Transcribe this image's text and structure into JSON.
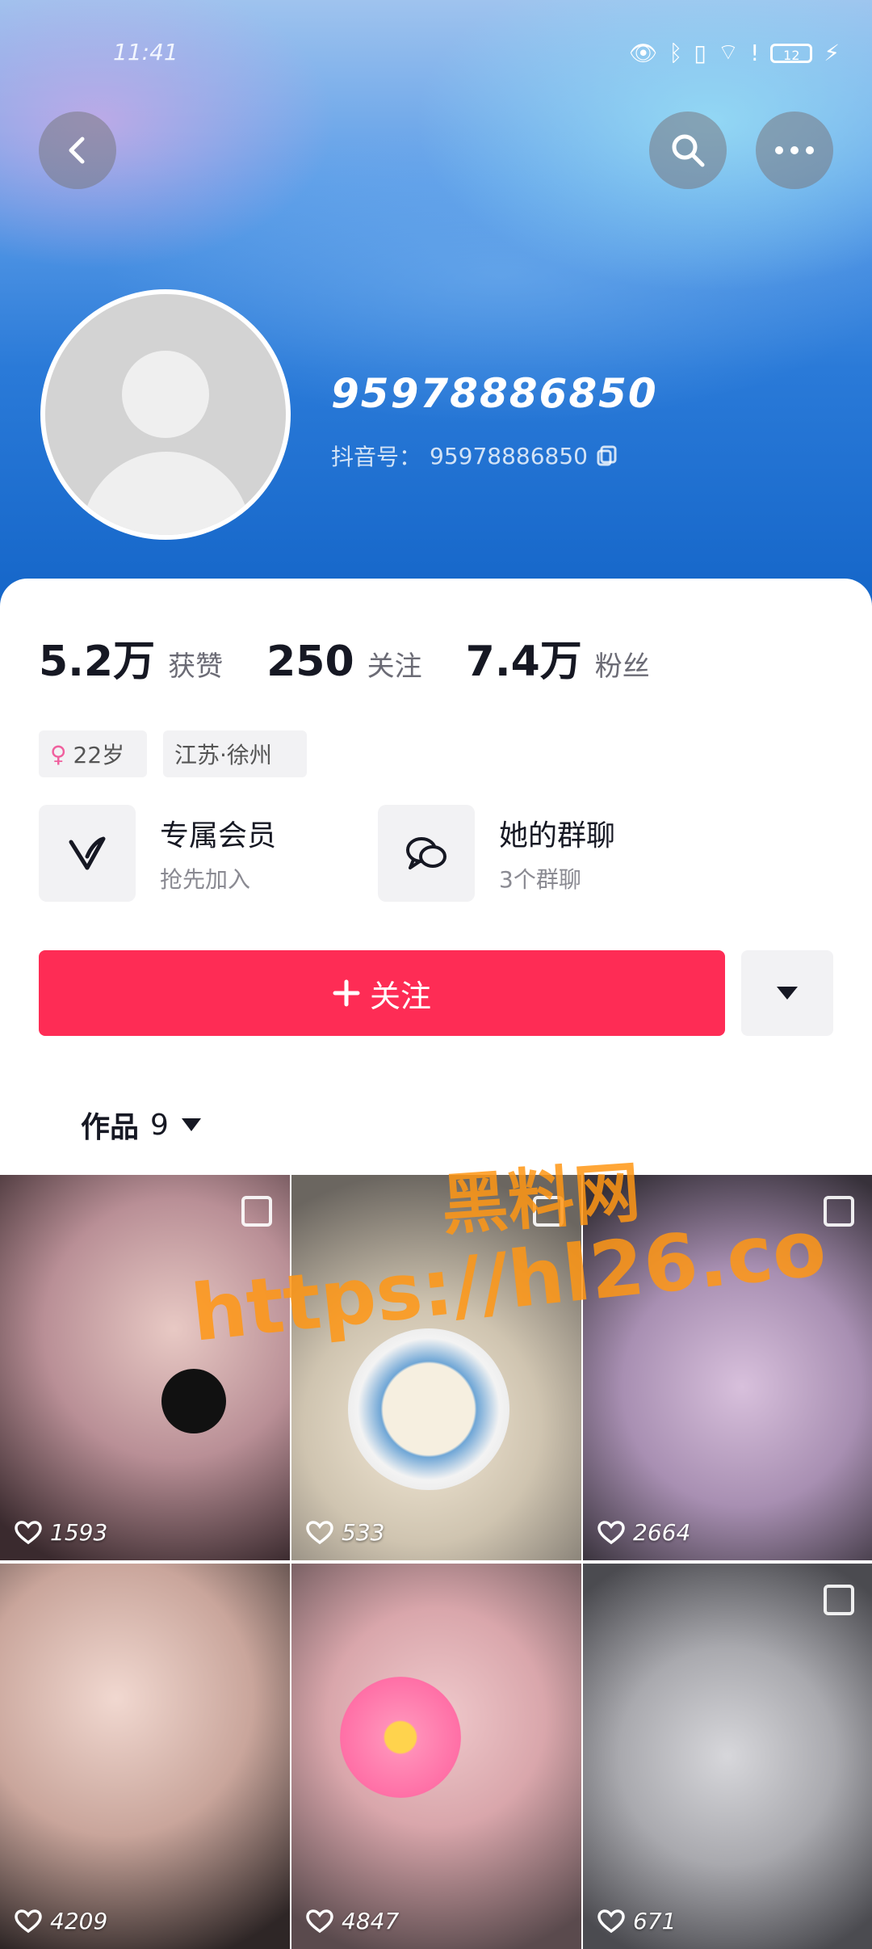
{
  "status_bar": {
    "time": "11:41",
    "battery": "12"
  },
  "profile": {
    "nickname": "95978886850",
    "id_label": "抖音号：",
    "id_value": "95978886850"
  },
  "stats": [
    {
      "num": "5.2万",
      "label": "获赞"
    },
    {
      "num": "250",
      "label": "关注"
    },
    {
      "num": "7.4万",
      "label": "粉丝"
    }
  ],
  "tags": {
    "age": "22岁",
    "location": "江苏·徐州"
  },
  "features": [
    {
      "title": "专属会员",
      "subtitle": "抢先加入",
      "icon": "v-logo-icon"
    },
    {
      "title": "她的群聊",
      "subtitle": "3个群聊",
      "icon": "chat-bubbles-icon"
    }
  ],
  "actions": {
    "follow_label": "关注"
  },
  "works_tab": {
    "label": "作品",
    "count": "9"
  },
  "grid": [
    {
      "likes": "1593",
      "multi": true
    },
    {
      "likes": "533",
      "multi": true
    },
    {
      "likes": "2664",
      "multi": true
    },
    {
      "likes": "4209",
      "multi": false
    },
    {
      "likes": "4847",
      "multi": false
    },
    {
      "likes": "671",
      "multi": true
    }
  ],
  "watermark": {
    "line1": "黑料网",
    "line2": "https://hl26.co"
  },
  "colors": {
    "accent": "#fe2c55",
    "hero_blue": "#1465c8",
    "tag_bg": "#f2f2f4"
  }
}
